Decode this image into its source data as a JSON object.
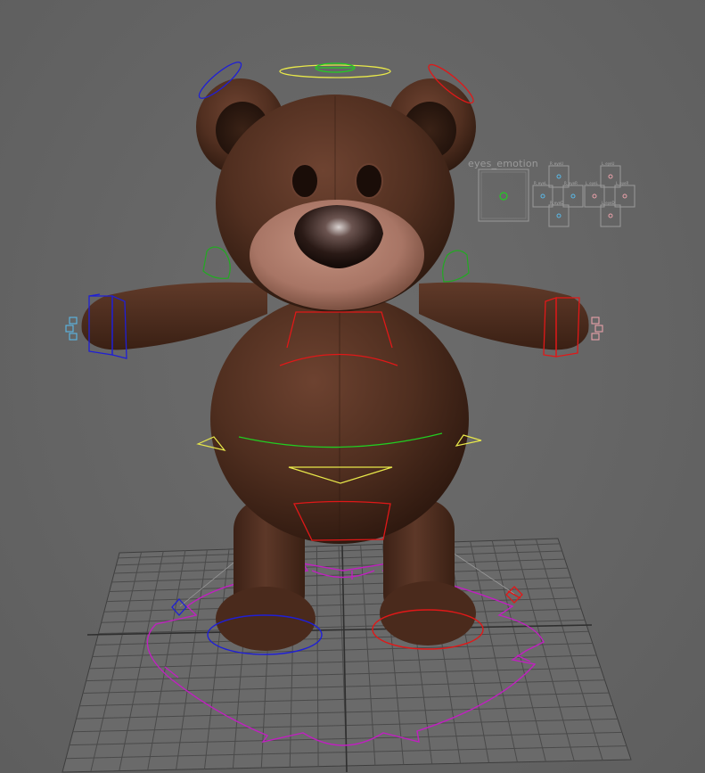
{
  "viewport": {
    "facial_panel": {
      "title": "eyes_emotion",
      "mini_labels": [
        "R_eyeU",
        "L_eyeU",
        "R_eyeL",
        "R_eyeR",
        "L_eyeL",
        "L_eyeR",
        "R_eyeD",
        "L_eyeD"
      ]
    }
  },
  "colors": {
    "background": "#666666",
    "grid": "#4a4a4a",
    "fur": "#4f2e1f",
    "muzzle": "#b08070",
    "left_side_controls": "#1f1fd6",
    "right_side_controls": "#e01818",
    "center_controls": "#22cc22",
    "spine_controls": "#e8e84a",
    "root_control": "#c020c0"
  },
  "icons": [
    "face-controller-box",
    "rig-control-curve",
    "root-arrow-control"
  ]
}
